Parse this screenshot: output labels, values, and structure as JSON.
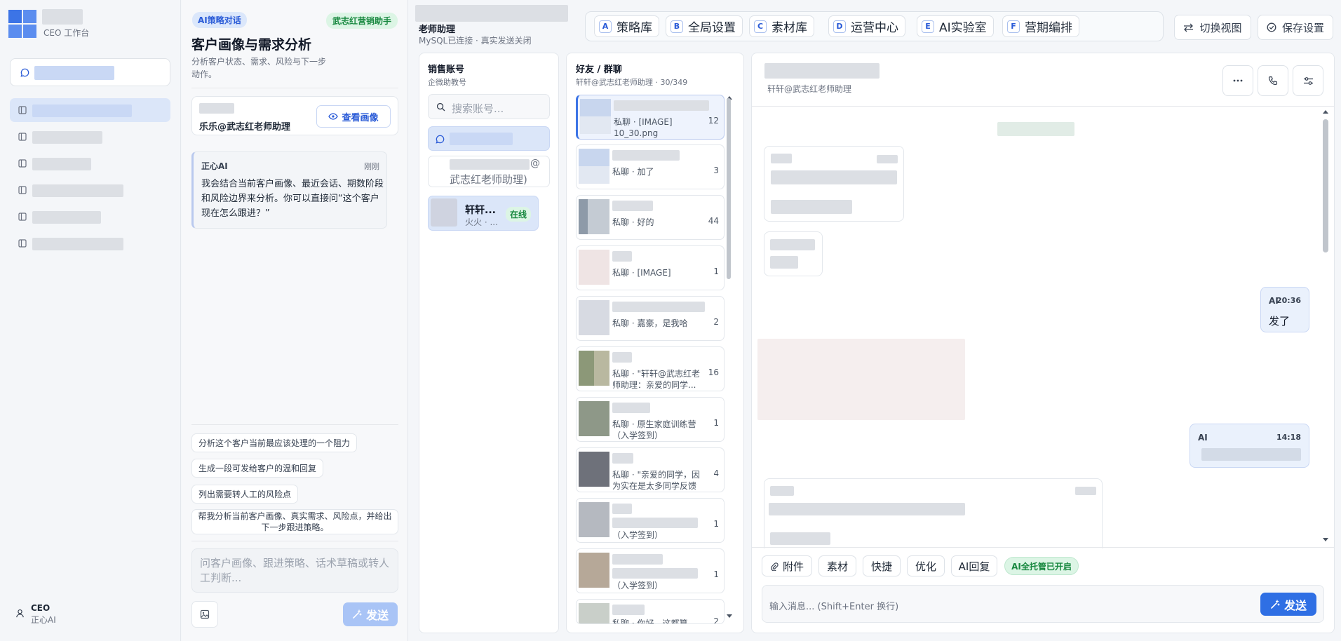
{
  "sidebar": {
    "brand_sub": "CEO 工作台",
    "user_name": "CEO",
    "user_role": "正心AI"
  },
  "ai_panel": {
    "tag": "AI策略对话",
    "badge": "武志红营销助手",
    "title": "客户画像与需求分析",
    "desc": "分析客户状态、需求、风险与下一步动作。",
    "customer_name": "乐乐@武志红老师助理",
    "view_profile": "查看画像",
    "msg_sender": "正心AI",
    "msg_time": "刚刚",
    "msg_text": "我会结合当前客户画像、最近会话、期数阶段和风险边界来分析。你可以直接问“这个客户现在怎么跟进？”",
    "quick": [
      "分析这个客户当前最应该处理的一个阻力",
      "生成一段可发给客户的温和回复",
      "列出需要转人工的风险点",
      "帮我分析当前客户画像、真实需求、风险点，并给出下一步跟进策略。"
    ],
    "input_placeholder": "问客户画像、跟进策略、话术草稿或转人工判断...",
    "send": "发送"
  },
  "topbar": {
    "status": "MySQL已连接 · 真实发送关闭",
    "tabs": [
      {
        "key": "A",
        "label": "策略库"
      },
      {
        "key": "B",
        "label": "全局设置"
      },
      {
        "key": "C",
        "label": "素材库"
      },
      {
        "key": "D",
        "label": "运营中心"
      },
      {
        "key": "E",
        "label": "AI实验室"
      },
      {
        "key": "F",
        "label": "营期编排"
      }
    ],
    "switch_view": "切换视图",
    "save_settings": "保存设置"
  },
  "accounts": {
    "teacher_title": "老师助理",
    "title": "销售账号",
    "sub": "企微助教号",
    "search_placeholder": "搜索账号...",
    "acc2_at": "@",
    "acc2_line2": "武志红老师助理)",
    "acc3_name": "轩轩...",
    "acc3_sub": "火火 · ...",
    "acc3_status": "在线"
  },
  "friends": {
    "title": "好友 / 群聊",
    "sub": "轩轩@武志红老师助理 · 30/349",
    "items": [
      {
        "preview": "私聊 · [IMAGE] 10_30.png",
        "count": "12"
      },
      {
        "preview": "私聊 · 加了",
        "count": "3"
      },
      {
        "preview": "私聊 · 好的",
        "count": "44"
      },
      {
        "preview": "私聊 · [IMAGE]",
        "count": "1"
      },
      {
        "preview": "私聊 · 嘉豪，是我哈",
        "count": "2"
      },
      {
        "preview": "私聊 · \"轩轩@武志红老师助理：亲爱的同学...",
        "count": "16"
      },
      {
        "preview": "私聊 · 原生家庭训练营（入学签到）",
        "count": "1"
      },
      {
        "preview": "私聊 · \"亲爱的同学，因为实在是太多同学反馈没...",
        "count": "4"
      },
      {
        "preview": "（入学签到）",
        "count": "1"
      },
      {
        "preview": "（入学签到）",
        "count": "1"
      },
      {
        "preview": "私聊 · 你好，这都算，课...",
        "count": "2"
      }
    ]
  },
  "chat": {
    "sub": "轩轩@武志红老师助理",
    "msg1_sender": "AI",
    "msg1_time": "20:36",
    "msg1_text": "发了",
    "msg2_sender": "AI",
    "msg2_time": "14:18",
    "chips": [
      "附件",
      "素材",
      "快捷",
      "优化",
      "AI回复"
    ],
    "ai_status": "AI全托管已开启",
    "input_placeholder": "输入消息... (Shift+Enter 换行)",
    "send": "发送"
  }
}
